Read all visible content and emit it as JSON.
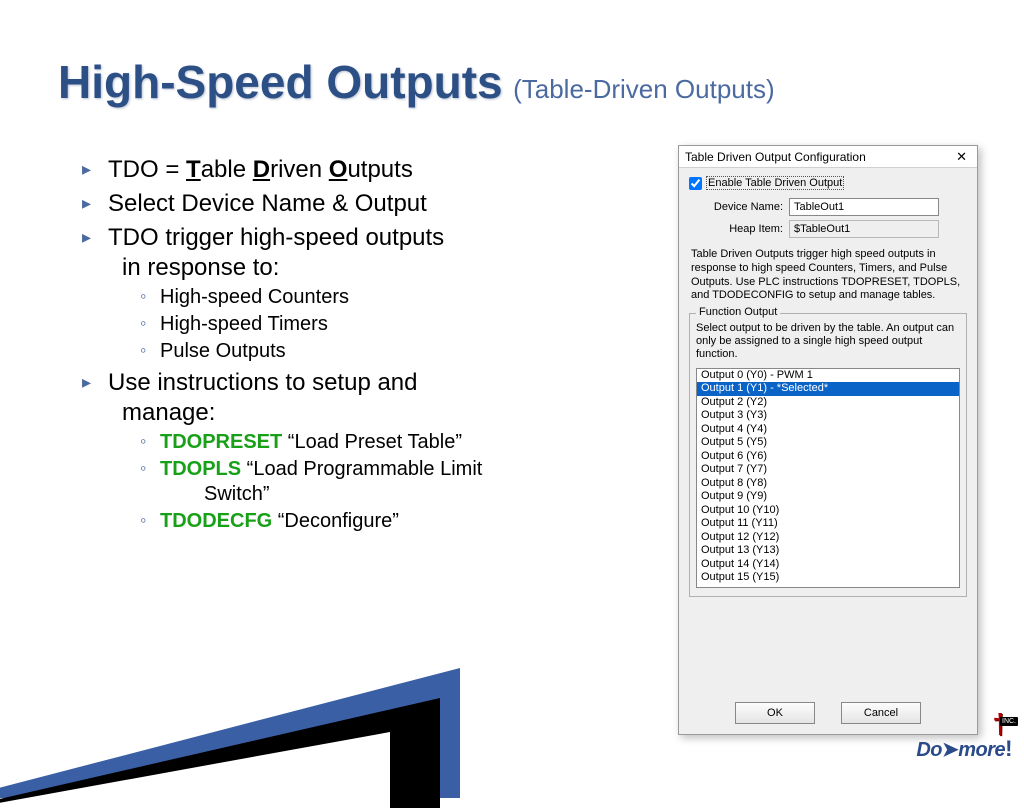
{
  "title": {
    "main": "High-Speed Outputs",
    "sub": "(Table-Driven Outputs)"
  },
  "bullets": {
    "b1": {
      "pre": "TDO = ",
      "t": "T",
      "mid1": "able ",
      "d": "D",
      "mid2": "riven ",
      "o": "O",
      "post": "utputs"
    },
    "b2": "Select Device Name & Output",
    "b3": {
      "line1": "TDO trigger high-speed outputs",
      "line2": "in response to:"
    },
    "b3sub": {
      "a": "High-speed Counters",
      "b": "High-speed Timers",
      "c": "Pulse Outputs"
    },
    "b4": {
      "line1": "Use instructions to setup and",
      "line2": "manage:"
    },
    "b4sub": {
      "a": {
        "kw": "TDOPRESET",
        "txt": " “Load Preset Table”"
      },
      "b": {
        "kw": "TDOPLS",
        "txt1": " “Load Programmable Limit",
        "txt2": "Switch”"
      },
      "c": {
        "kw": "TDODECFG",
        "txt": " “Deconfigure”"
      }
    }
  },
  "dialog": {
    "title": "Table Driven Output Configuration",
    "enable": "Enable Table Driven Output",
    "deviceLabel": "Device Name:",
    "deviceValue": "TableOut1",
    "heapLabel": "Heap Item:",
    "heapValue": "$TableOut1",
    "desc": "Table Driven Outputs trigger high speed outputs in response to high speed Counters, Timers, and Pulse Outputs. Use PLC instructions TDOPRESET, TDOPLS, and TDODECONFIG to setup and manage tables.",
    "fsTitle": "Function Output",
    "fsDesc": "Select output to be driven by the table. An output can only be assigned to a single high speed output function.",
    "outputs": [
      "Output 0 (Y0) - PWM 1",
      "Output 1 (Y1) - *Selected*",
      "Output 2 (Y2)",
      "Output 3 (Y3)",
      "Output 4 (Y4)",
      "Output 5 (Y5)",
      "Output 6 (Y6)",
      "Output 7 (Y7)",
      "Output 8 (Y8)",
      "Output 9 (Y9)",
      "Output 10 (Y10)",
      "Output 11 (Y11)",
      "Output 12 (Y12)",
      "Output 13 (Y13)",
      "Output 14 (Y14)",
      "Output 15 (Y15)"
    ],
    "selectedIndex": 1,
    "ok": "OK",
    "cancel": "Cancel"
  },
  "logo": {
    "text1": "Do",
    "arrow": "➤",
    "text2": "more",
    "mark": "†",
    "inc": "INC."
  }
}
